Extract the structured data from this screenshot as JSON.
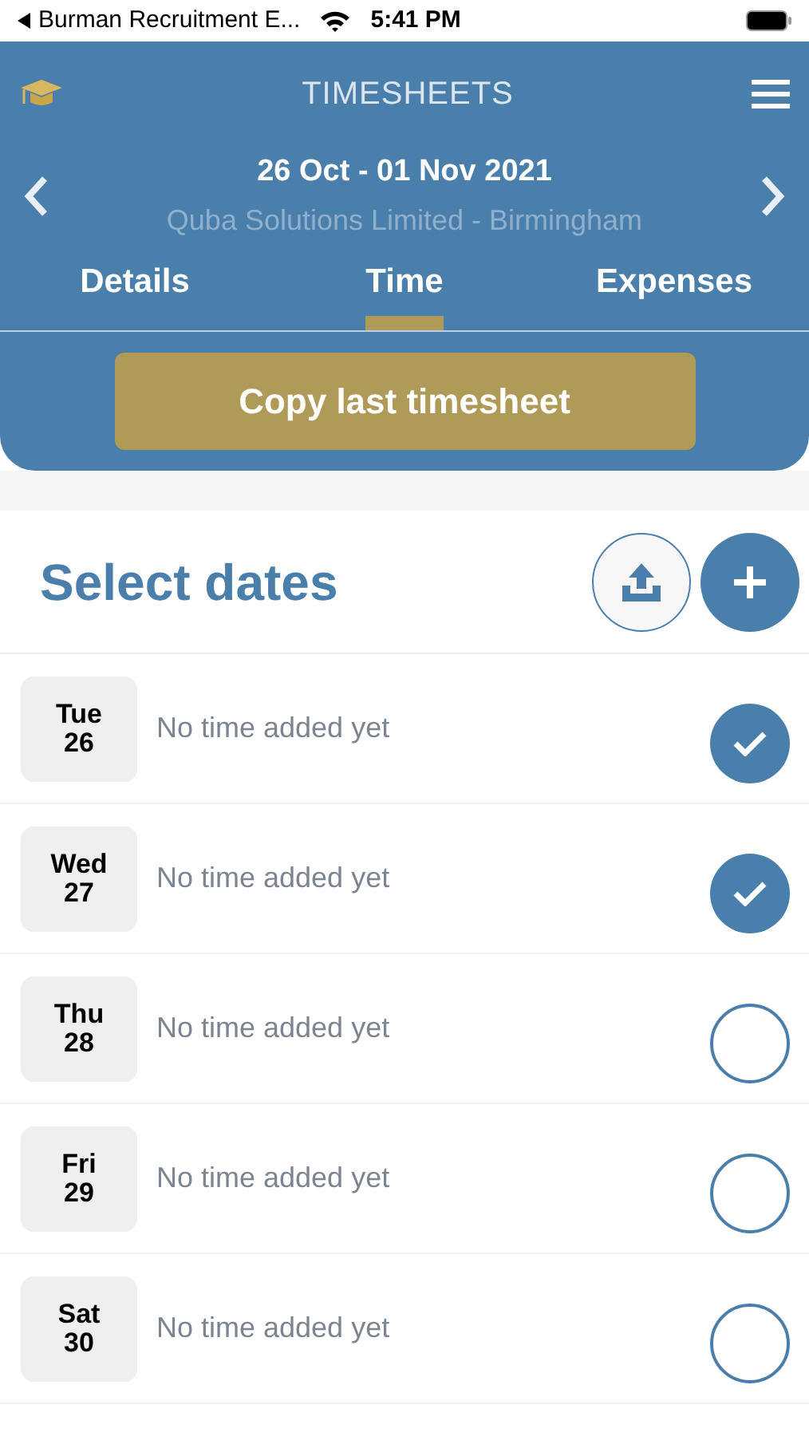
{
  "status_bar": {
    "back_app": "Burman Recruitment E...",
    "time": "5:41 PM"
  },
  "header": {
    "title": "TIMESHEETS",
    "period": "26 Oct - 01 Nov 2021",
    "company": "Quba Solutions Limited - Birmingham"
  },
  "tabs": [
    {
      "label": "Details",
      "selected": false
    },
    {
      "label": "Time",
      "selected": true
    },
    {
      "label": "Expenses",
      "selected": false
    }
  ],
  "copy_button": "Copy last timesheet",
  "section_title": "Select dates",
  "days": [
    {
      "weekday": "Tue",
      "day": "26",
      "status": "No time added yet",
      "selected": true
    },
    {
      "weekday": "Wed",
      "day": "27",
      "status": "No time added yet",
      "selected": true
    },
    {
      "weekday": "Thu",
      "day": "28",
      "status": "No time added yet",
      "selected": false
    },
    {
      "weekday": "Fri",
      "day": "29",
      "status": "No time added yet",
      "selected": false
    },
    {
      "weekday": "Sat",
      "day": "30",
      "status": "No time added yet",
      "selected": false
    }
  ]
}
